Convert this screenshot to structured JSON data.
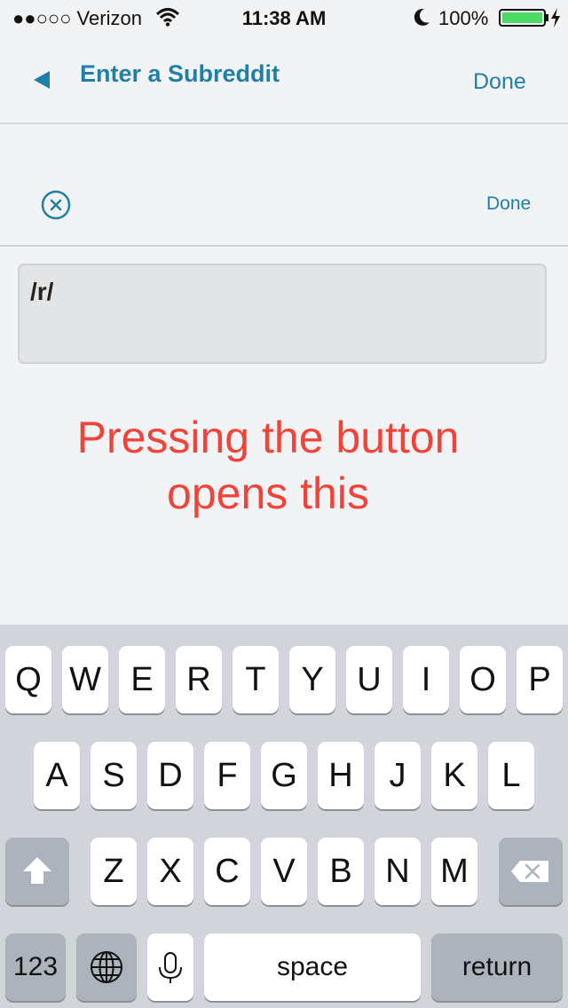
{
  "status_bar": {
    "carrier": "●●○○○ Verizon",
    "time": "11:38 AM",
    "battery_percent": "100%",
    "icons": [
      "wifi-icon",
      "moon-icon",
      "battery-icon",
      "charging-bolt-icon"
    ]
  },
  "nav": {
    "title": "Enter a Subreddit",
    "done_label": "Done",
    "back_icon": "back-triangle-icon"
  },
  "toolbar": {
    "done_label": "Done",
    "clear_icon": "circle-x-icon"
  },
  "subreddit_field": {
    "value": "/r/"
  },
  "annotation": {
    "line1": "Pressing the button",
    "line2": "opens this"
  },
  "keyboard": {
    "row1": [
      "Q",
      "W",
      "E",
      "R",
      "T",
      "Y",
      "U",
      "I",
      "O",
      "P"
    ],
    "row2": [
      "A",
      "S",
      "D",
      "F",
      "G",
      "H",
      "J",
      "K",
      "L"
    ],
    "row3": [
      "Z",
      "X",
      "C",
      "V",
      "B",
      "N",
      "M"
    ],
    "numbers_label": "123",
    "space_label": "space",
    "return_label": "return",
    "icons": [
      "shift-icon",
      "backspace-icon",
      "globe-icon",
      "microphone-icon"
    ]
  },
  "colors": {
    "accent": "#1f7fa6",
    "annotation": "#f0443a",
    "keyboard_bg": "#d1d4d9",
    "battery": "#4cd964"
  }
}
